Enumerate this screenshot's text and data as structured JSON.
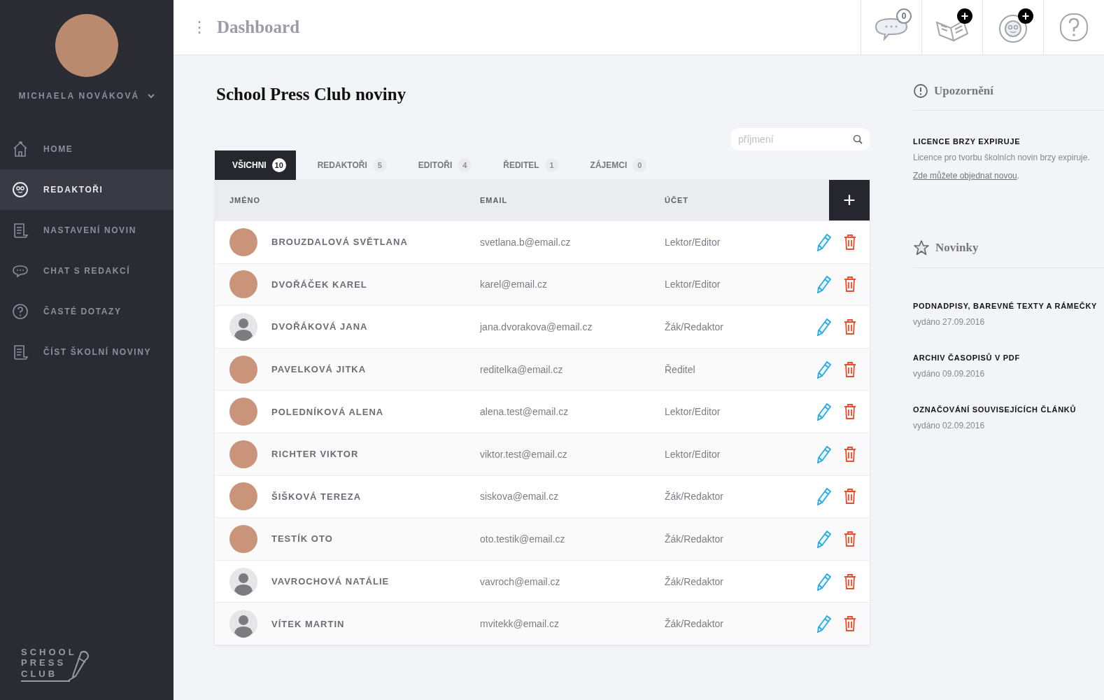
{
  "sidebar": {
    "user": {
      "name": "MICHAELA NOVÁKOVÁ"
    },
    "items": [
      {
        "label": "HOME",
        "kind": "house",
        "selected": false
      },
      {
        "label": "REDAKTOŘI",
        "kind": "face",
        "selected": true
      },
      {
        "label": "NASTAVENÍ NOVIN",
        "kind": "scroll",
        "selected": false
      },
      {
        "label": "CHAT S REDAKCÍ",
        "kind": "chat",
        "selected": false
      },
      {
        "label": "ČASTÉ DOTAZY",
        "kind": "question",
        "selected": false
      },
      {
        "label": "ČÍST ŠKOLNÍ NOVINY",
        "kind": "scroll",
        "selected": false
      }
    ],
    "logo": [
      "SCHOOL",
      "PRESS",
      "CLUB"
    ]
  },
  "header": {
    "title": "Dashboard",
    "menu_glyph": "⋮",
    "buttons": [
      {
        "kind": "chat",
        "badge": {
          "text": "0",
          "filled": false
        }
      },
      {
        "kind": "book",
        "badge": {
          "text": "+",
          "filled": true
        }
      },
      {
        "kind": "face",
        "badge": {
          "text": "+",
          "filled": true
        }
      },
      {
        "kind": "question"
      }
    ]
  },
  "page_title": "School Press Club noviny",
  "search": {
    "placeholder": "příjmení"
  },
  "tabs": [
    {
      "label": "VŠICHNI",
      "count": "10",
      "selected": true
    },
    {
      "label": "REDAKTOŘI",
      "count": "5",
      "selected": false
    },
    {
      "label": "EDITOŘI",
      "count": "4",
      "selected": false
    },
    {
      "label": "ŘEDITEL",
      "count": "1",
      "selected": false
    },
    {
      "label": "ZÁJEMCI",
      "count": "0",
      "selected": false
    }
  ],
  "table": {
    "columns": [
      "JMÉNO",
      "EMAIL",
      "ÚČET"
    ],
    "add_glyph": "+",
    "rows": [
      {
        "kind": "photo",
        "name": "BROUZDALOVÁ SVĚTLANA",
        "email": "svetlana.b@email.cz",
        "account": "Lektor/Editor"
      },
      {
        "kind": "photo",
        "name": "DVOŘÁČEK KAREL",
        "email": "karel@email.cz",
        "account": "Lektor/Editor"
      },
      {
        "kind": "default",
        "name": "DVOŘÁKOVÁ JANA",
        "email": "jana.dvorakova@email.cz",
        "account": "Žák/Redaktor"
      },
      {
        "kind": "photo",
        "name": "PAVELKOVÁ JITKA",
        "email": "reditelka@email.cz",
        "account": "Ředitel"
      },
      {
        "kind": "photo",
        "name": "POLEDNÍKOVÁ ALENA",
        "email": "alena.test@email.cz",
        "account": "Lektor/Editor"
      },
      {
        "kind": "photo",
        "name": "RICHTER VIKTOR",
        "email": "viktor.test@email.cz",
        "account": "Lektor/Editor"
      },
      {
        "kind": "photo",
        "name": "ŠIŠKOVÁ TEREZA",
        "email": "siskova@email.cz",
        "account": "Žák/Redaktor"
      },
      {
        "kind": "photo",
        "name": "TESTÍK OTO",
        "email": "oto.testik@email.cz",
        "account": "Žák/Redaktor"
      },
      {
        "kind": "default",
        "name": "VAVROCHOVÁ NATÁLIE",
        "email": "vavroch@email.cz",
        "account": "Žák/Redaktor"
      },
      {
        "kind": "default",
        "name": "VÍTEK MARTIN",
        "email": "mvitekk@email.cz",
        "account": "Žák/Redaktor"
      }
    ]
  },
  "notices": {
    "title": "Upozornění",
    "items": [
      {
        "heading": "LICENCE BRZY EXPIRUJE",
        "text": "Licence pro tvorbu školních novin brzy expiruje.",
        "link": "Zde můžete objednat novou",
        "after_link": "."
      }
    ]
  },
  "news": {
    "title": "Novinky",
    "items": [
      {
        "heading": "PODNADPISY, BAREVNÉ TEXTY A RÁMEČKY",
        "date": "vydáno 27.09.2016"
      },
      {
        "heading": "ARCHIV ČASOPISŮ V PDF",
        "date": "vydáno 09.09.2016"
      },
      {
        "heading": "OZNAČOVÁNÍ SOUVISEJÍCÍCH ČLÁNKŮ",
        "date": "vydáno 02.09.2016"
      }
    ]
  }
}
